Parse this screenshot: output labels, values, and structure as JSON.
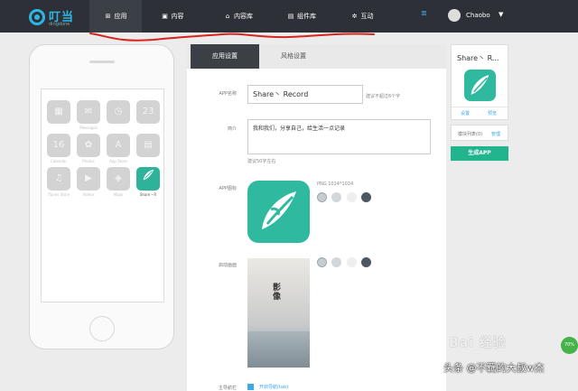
{
  "brand": {
    "name": "叮当",
    "sub": "dingdone"
  },
  "nav": [
    {
      "label": "应用",
      "icon": "⊞",
      "icon_name": "grid-icon",
      "active": true
    },
    {
      "label": "内容",
      "icon": "▣",
      "icon_name": "content-icon"
    },
    {
      "label": "内容库",
      "icon": "⌂",
      "icon_name": "library-icon"
    },
    {
      "label": "组件库",
      "icon": "▤",
      "icon_name": "components-icon"
    },
    {
      "label": "互动",
      "icon": "✲",
      "icon_name": "interact-icon"
    }
  ],
  "header": {
    "bell_glyph": "≣",
    "username": "Chaobo",
    "caret": "▼"
  },
  "phone": {
    "apps": [
      {
        "label": "",
        "glyph": "▦"
      },
      {
        "label": "Messages",
        "glyph": "✉"
      },
      {
        "label": "",
        "glyph": "◷"
      },
      {
        "label": "",
        "glyph": "23"
      },
      {
        "label": "Calendar",
        "glyph": "16"
      },
      {
        "label": "Photos",
        "glyph": "✿"
      },
      {
        "label": "App Store",
        "glyph": "A"
      },
      {
        "label": "",
        "glyph": "▤"
      },
      {
        "label": "iTunes Store",
        "glyph": "♫"
      },
      {
        "label": "Videos",
        "glyph": "▶"
      },
      {
        "label": "Maps",
        "glyph": "◈"
      },
      {
        "label": "Share丶R",
        "glyph": "",
        "highlight": true
      }
    ]
  },
  "form": {
    "tabs": [
      "应用设置",
      "风格设置"
    ],
    "app_name_label": "APP名称",
    "app_name_value": "Share丶 Record",
    "app_name_hint": "建议不超过6个字",
    "intro_label": "简介",
    "intro_value": "我和我们，分享自己，给生活一点记录",
    "intro_hint": "建议50字左右",
    "icon_label": "APP图标",
    "icon_spec": "PNG 1024*1024",
    "splash_label": "启动画面",
    "splash_title": "影像",
    "bottom_label": "主导航栏",
    "bottom_link": "开启导航(tab)"
  },
  "colors": {
    "swatches": [
      "#c8ccd2",
      "#d3d7db",
      "#eeeeee",
      "#4d5663"
    ],
    "accent": "#21b48d",
    "icon_bg": "#2fbaa0"
  },
  "sidebar": {
    "app_title": "Share丶 R...",
    "link_settings": "设置",
    "link_preview": "预览",
    "modules_label": "模块列表(0)",
    "modules_link": "管理",
    "generate_button": "生成APP"
  },
  "watermark": {
    "badge": "70%",
    "baidu": "Bai 经验",
    "credit": "头条 @不羈的大叔w杰"
  }
}
